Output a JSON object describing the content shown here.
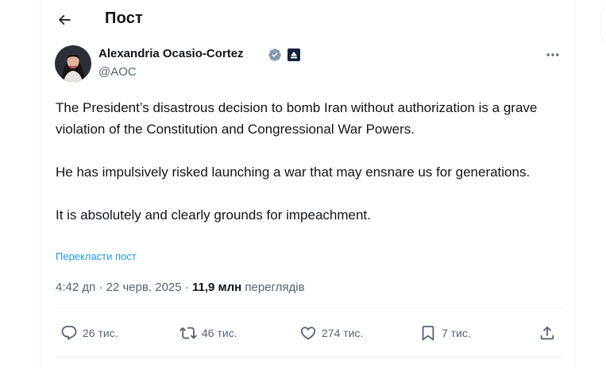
{
  "header": {
    "title": "Пост",
    "back_icon": "arrow-left-icon"
  },
  "author": {
    "name": "Alexandria Ocasio-Cortez",
    "handle": "@AOC",
    "verified_icon": "verified-badge-icon",
    "affiliate_icon": "affiliate-badge-icon",
    "verified_color": "#829aab"
  },
  "post": {
    "paragraphs": [
      "The President’s disastrous decision to bomb Iran without authorization is a grave violation of the Constitution and Congressional War Powers.",
      "He has impulsively risked launching a war that may ensnare us for generations.",
      "It is absolutely and clearly grounds for impeachment."
    ],
    "translate_label": "Перекласти пост",
    "time": "4:42 дп",
    "separator": " · ",
    "date": "22 черв. 2025",
    "views_count": "11,9 млн",
    "views_label": "переглядів"
  },
  "actions": {
    "reply": {
      "icon": "reply-icon",
      "count": "26 тис."
    },
    "repost": {
      "icon": "repost-icon",
      "count": "46 тис."
    },
    "like": {
      "icon": "heart-icon",
      "count": "274 тис."
    },
    "bookmark": {
      "icon": "bookmark-icon",
      "count": "7 тис."
    },
    "share": {
      "icon": "share-icon"
    }
  },
  "colors": {
    "text": "#0f1419",
    "secondary": "#536471",
    "link": "#1d9bf0",
    "border": "#eff3f4"
  }
}
